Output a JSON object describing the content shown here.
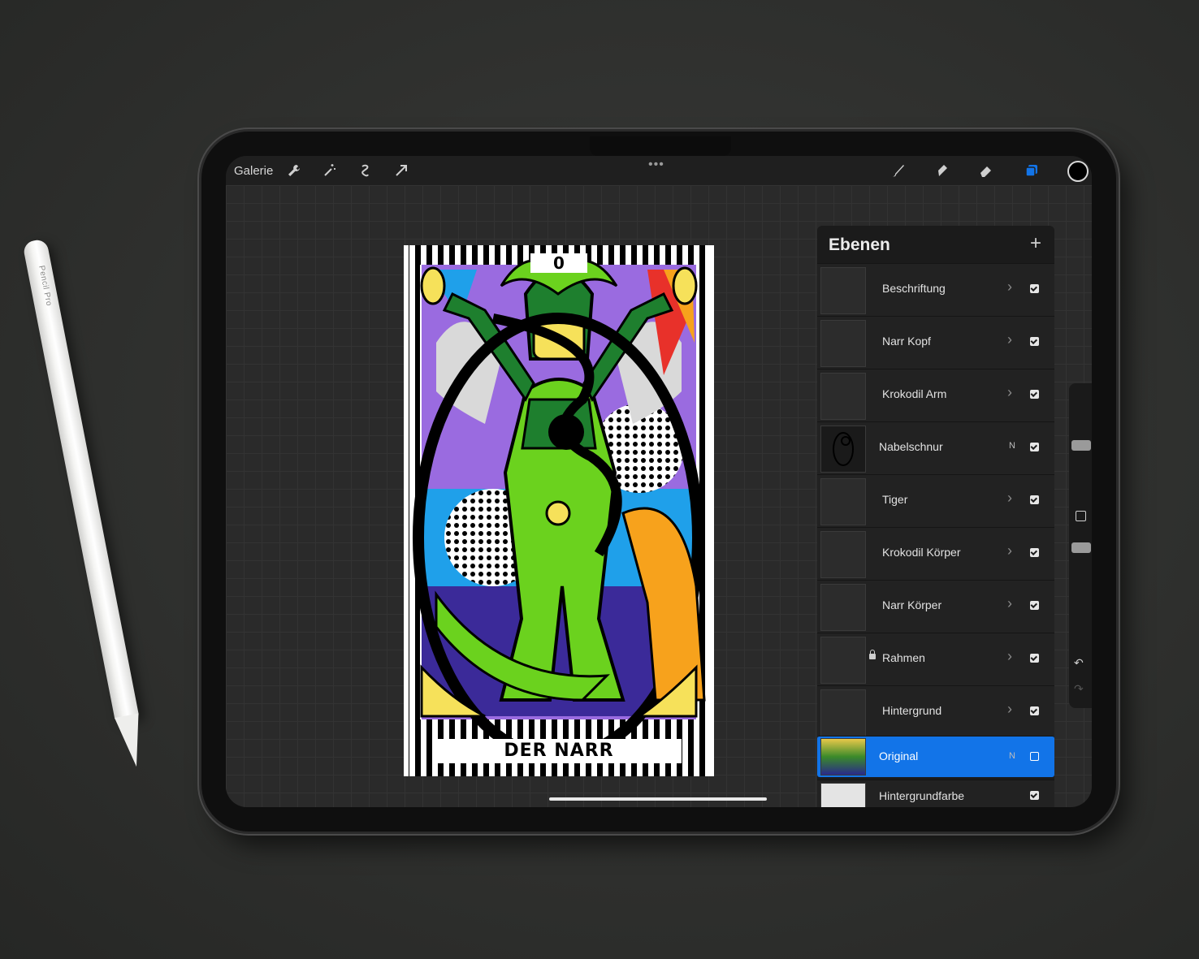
{
  "pencil": {
    "label": "Pencil Pro"
  },
  "toolbar": {
    "gallery_label": "Galerie",
    "tools": [
      "wrench-icon",
      "magic-wand-icon",
      "selection-icon",
      "transform-arrow-icon"
    ],
    "right_tools": [
      "brush-icon",
      "smudge-icon",
      "eraser-icon",
      "layers-icon"
    ],
    "current_color": "#000000",
    "accent_color": "#1274e8"
  },
  "card": {
    "number": "0",
    "title": "DER NARR"
  },
  "layers_panel": {
    "title": "Ebenen",
    "add_label": "+",
    "layers": [
      {
        "name": "Beschriftung",
        "type": "group",
        "visible": true
      },
      {
        "name": "Narr Kopf",
        "type": "group",
        "visible": true
      },
      {
        "name": "Krokodil Arm",
        "type": "group",
        "visible": true
      },
      {
        "name": "Nabelschnur",
        "type": "layer",
        "mode": "N",
        "visible": true
      },
      {
        "name": "Tiger",
        "type": "group",
        "visible": true
      },
      {
        "name": "Krokodil Körper",
        "type": "group",
        "visible": true
      },
      {
        "name": "Narr Körper",
        "type": "group",
        "visible": true
      },
      {
        "name": "Rahmen",
        "type": "group",
        "locked": true,
        "visible": true
      },
      {
        "name": "Hintergrund",
        "type": "group",
        "visible": true
      },
      {
        "name": "Original",
        "type": "layer",
        "mode": "N",
        "visible": false,
        "selected": true
      },
      {
        "name": "Hintergrundfarbe",
        "type": "background",
        "visible": true
      }
    ]
  }
}
